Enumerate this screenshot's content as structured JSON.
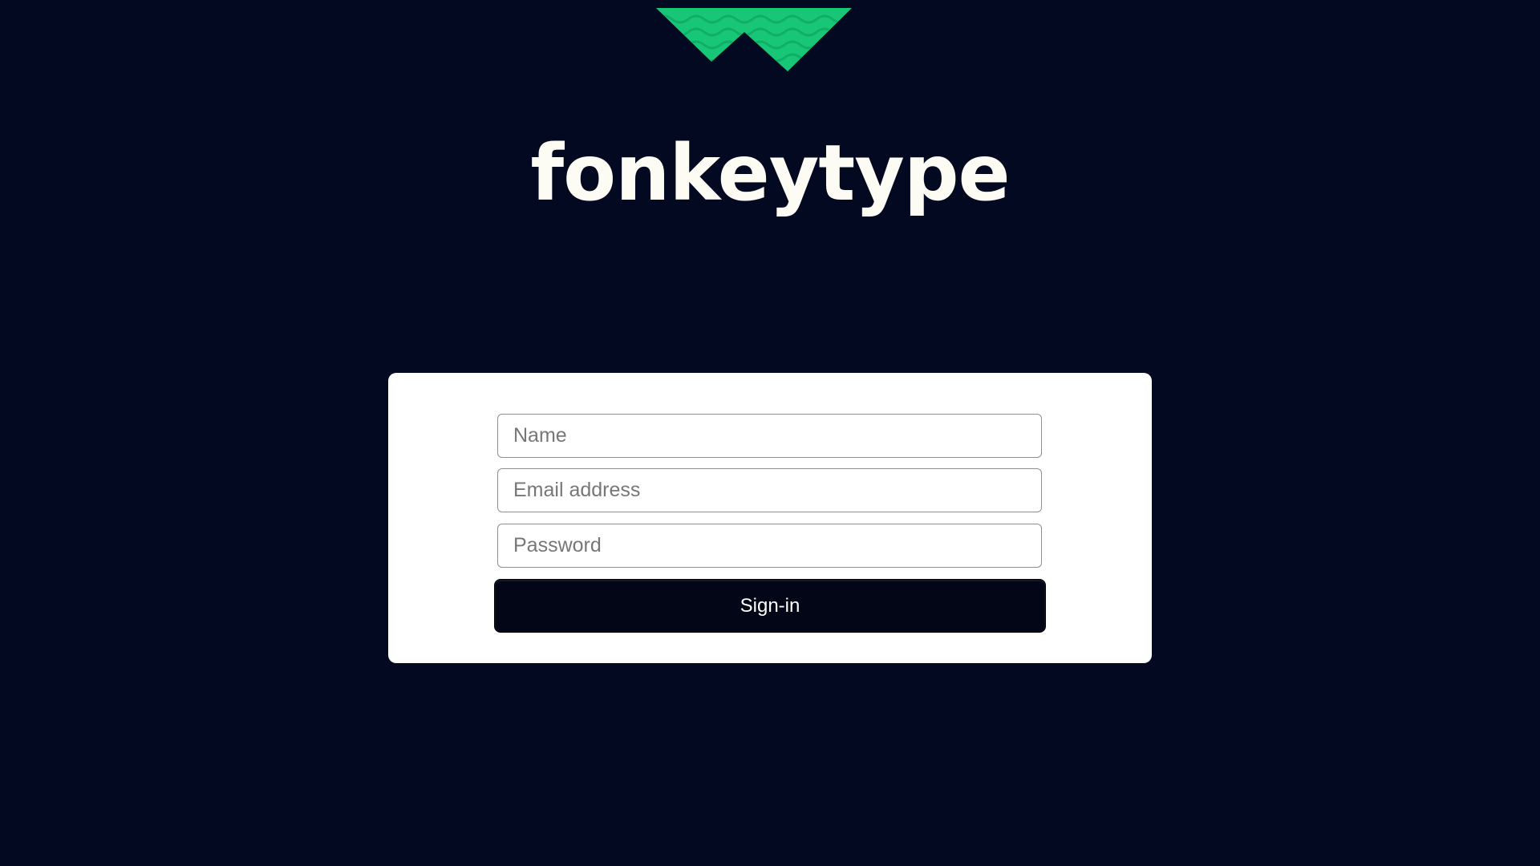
{
  "brand": {
    "wordmark": "fonkeytype",
    "logo_icon": "wave-chevron-logo",
    "logo_color": "#17c777"
  },
  "colors": {
    "background": "#020920",
    "card": "#ffffff",
    "button": "#020616"
  },
  "form": {
    "name_placeholder": "Name",
    "email_placeholder": "Email address",
    "password_placeholder": "Password",
    "submit_label": "Sign-in"
  }
}
